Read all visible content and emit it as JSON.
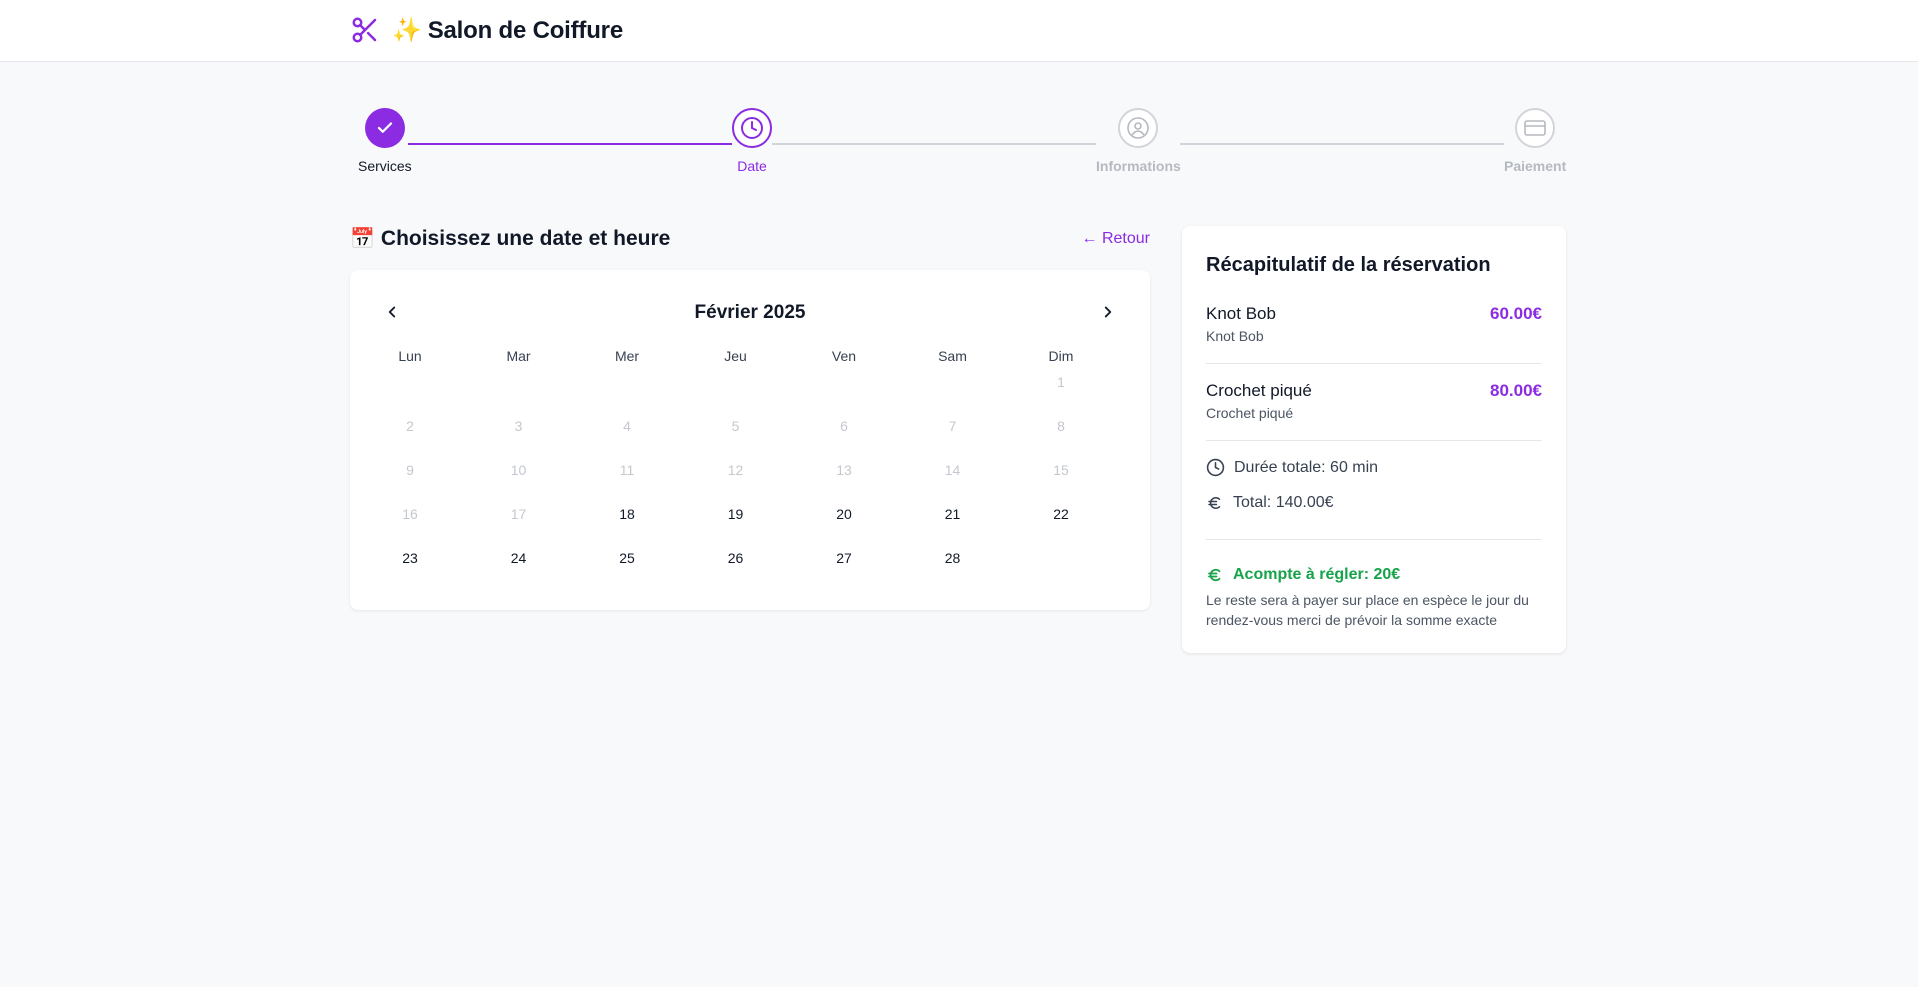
{
  "header": {
    "sparkle": "✨",
    "title": "Salon de Coiffure"
  },
  "steps": [
    {
      "label": "Services",
      "state": "done"
    },
    {
      "label": "Date",
      "state": "active"
    },
    {
      "label": "Informations",
      "state": "todo"
    },
    {
      "label": "Paiement",
      "state": "todo"
    }
  ],
  "section": {
    "emoji": "📅",
    "title": "Choisissez une date et heure",
    "back": "← Retour"
  },
  "calendar": {
    "month": "Février 2025",
    "weekdays": [
      "Lun",
      "Mar",
      "Mer",
      "Jeu",
      "Ven",
      "Sam",
      "Dim"
    ],
    "weeks": [
      [
        null,
        null,
        null,
        null,
        null,
        null,
        {
          "d": "1",
          "on": false
        }
      ],
      [
        {
          "d": "2",
          "on": false
        },
        {
          "d": "3",
          "on": false
        },
        {
          "d": "4",
          "on": false
        },
        {
          "d": "5",
          "on": false
        },
        {
          "d": "6",
          "on": false
        },
        {
          "d": "7",
          "on": false
        },
        {
          "d": "8",
          "on": false
        }
      ],
      [
        {
          "d": "9",
          "on": false
        },
        {
          "d": "10",
          "on": false
        },
        {
          "d": "11",
          "on": false
        },
        {
          "d": "12",
          "on": false
        },
        {
          "d": "13",
          "on": false
        },
        {
          "d": "14",
          "on": false
        },
        {
          "d": "15",
          "on": false
        }
      ],
      [
        {
          "d": "16",
          "on": false
        },
        {
          "d": "17",
          "on": false
        },
        {
          "d": "18",
          "on": true
        },
        {
          "d": "19",
          "on": true
        },
        {
          "d": "20",
          "on": true
        },
        {
          "d": "21",
          "on": true
        },
        {
          "d": "22",
          "on": true
        }
      ],
      [
        {
          "d": "23",
          "on": true
        },
        {
          "d": "24",
          "on": true
        },
        {
          "d": "25",
          "on": true
        },
        {
          "d": "26",
          "on": true
        },
        {
          "d": "27",
          "on": true
        },
        {
          "d": "28",
          "on": true
        },
        null
      ]
    ]
  },
  "summary": {
    "title": "Récapitulatif de la réservation",
    "services": [
      {
        "name": "Knot Bob",
        "sub": "Knot Bob",
        "price": "60.00€"
      },
      {
        "name": "Crochet piqué",
        "sub": "Crochet piqué",
        "price": "80.00€"
      }
    ],
    "duration": "Durée totale: 60 min",
    "total": "Total: 140.00€",
    "deposit": "Acompte à régler: 20€",
    "deposit_note": "Le reste sera à payer sur place en espèce le jour du rendez-vous merci de prévoir la somme exacte"
  },
  "colors": {
    "accent": "#8b2be2",
    "success": "#16a34a",
    "muted": "#d1d5db"
  }
}
